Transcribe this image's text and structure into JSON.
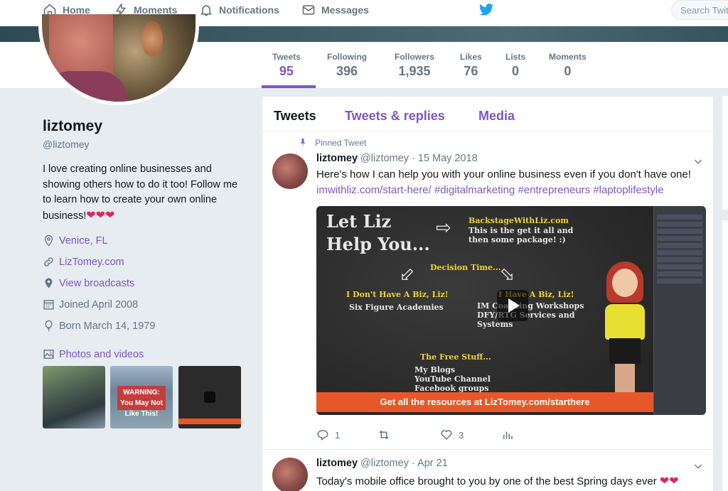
{
  "nav": {
    "home": "Home",
    "moments": "Moments",
    "notifications": "Notifications",
    "messages": "Messages",
    "search_placeholder": "Search Twitter"
  },
  "stats": [
    {
      "label": "Tweets",
      "value": "95"
    },
    {
      "label": "Following",
      "value": "396"
    },
    {
      "label": "Followers",
      "value": "1,935"
    },
    {
      "label": "Likes",
      "value": "76"
    },
    {
      "label": "Lists",
      "value": "0"
    },
    {
      "label": "Moments",
      "value": "0"
    }
  ],
  "profile": {
    "name": "liztomey",
    "handle": "@liztomey",
    "bio": "I love creating online businesses and showing others how to do it too! Follow me to learn how to create your own online business!",
    "bio_hearts": "❤❤❤",
    "location": "Venice, FL",
    "website": "LizTomey.com",
    "broadcasts": "View broadcasts",
    "joined": "Joined April 2008",
    "born": "Born March 14, 1979",
    "photos_label": "Photos and videos",
    "thumb2_text": "WARNING: You May Not Like This!"
  },
  "tabs": {
    "tweets": "Tweets",
    "replies": "Tweets & replies",
    "media": "Media"
  },
  "tweets": [
    {
      "pinned": "Pinned Tweet",
      "name": "liztomey",
      "handle": "@liztomey",
      "date": "· 15 May 2018",
      "text": "Here's how I can help you with your online business even if you don't have one!",
      "links": "imwithliz.com/start-here/ #digitalmarketing #entrepreneurs #laptoplifestyle",
      "replies": "1",
      "likes": "3",
      "video": {
        "title1": "Let Liz",
        "title2": "Help You...",
        "backstage": "BackstageWithLiz.com",
        "backstage_desc1": "This is the get it all and",
        "backstage_desc2": "then some package! :)",
        "decision": "Decision Time...",
        "nobiz": "I Don't Have A Biz, Liz!",
        "nobiz_desc": "Six Figure Academies",
        "havebiz": "I Have A Biz, Liz!",
        "havebiz_desc1": "IM Coaching Workshops",
        "havebiz_desc2": "DFY/RTG Services and",
        "havebiz_desc3": "Systems",
        "free": "The Free Stuff...",
        "free1": "My Blogs",
        "free2": "YouTube Channel",
        "free3": "Facebook groups",
        "bar": "Get all the resources at LizTomey.com/starthere"
      }
    },
    {
      "name": "liztomey",
      "handle": "@liztomey",
      "date": "· Apr 21",
      "text": "Today's mobile office brought to you by one of the best Spring days ever",
      "hearts": "❤❤"
    }
  ],
  "colors": {
    "accent": "#7e57c2",
    "twitter_blue": "#1da1f2",
    "heart": "#e0245e"
  }
}
